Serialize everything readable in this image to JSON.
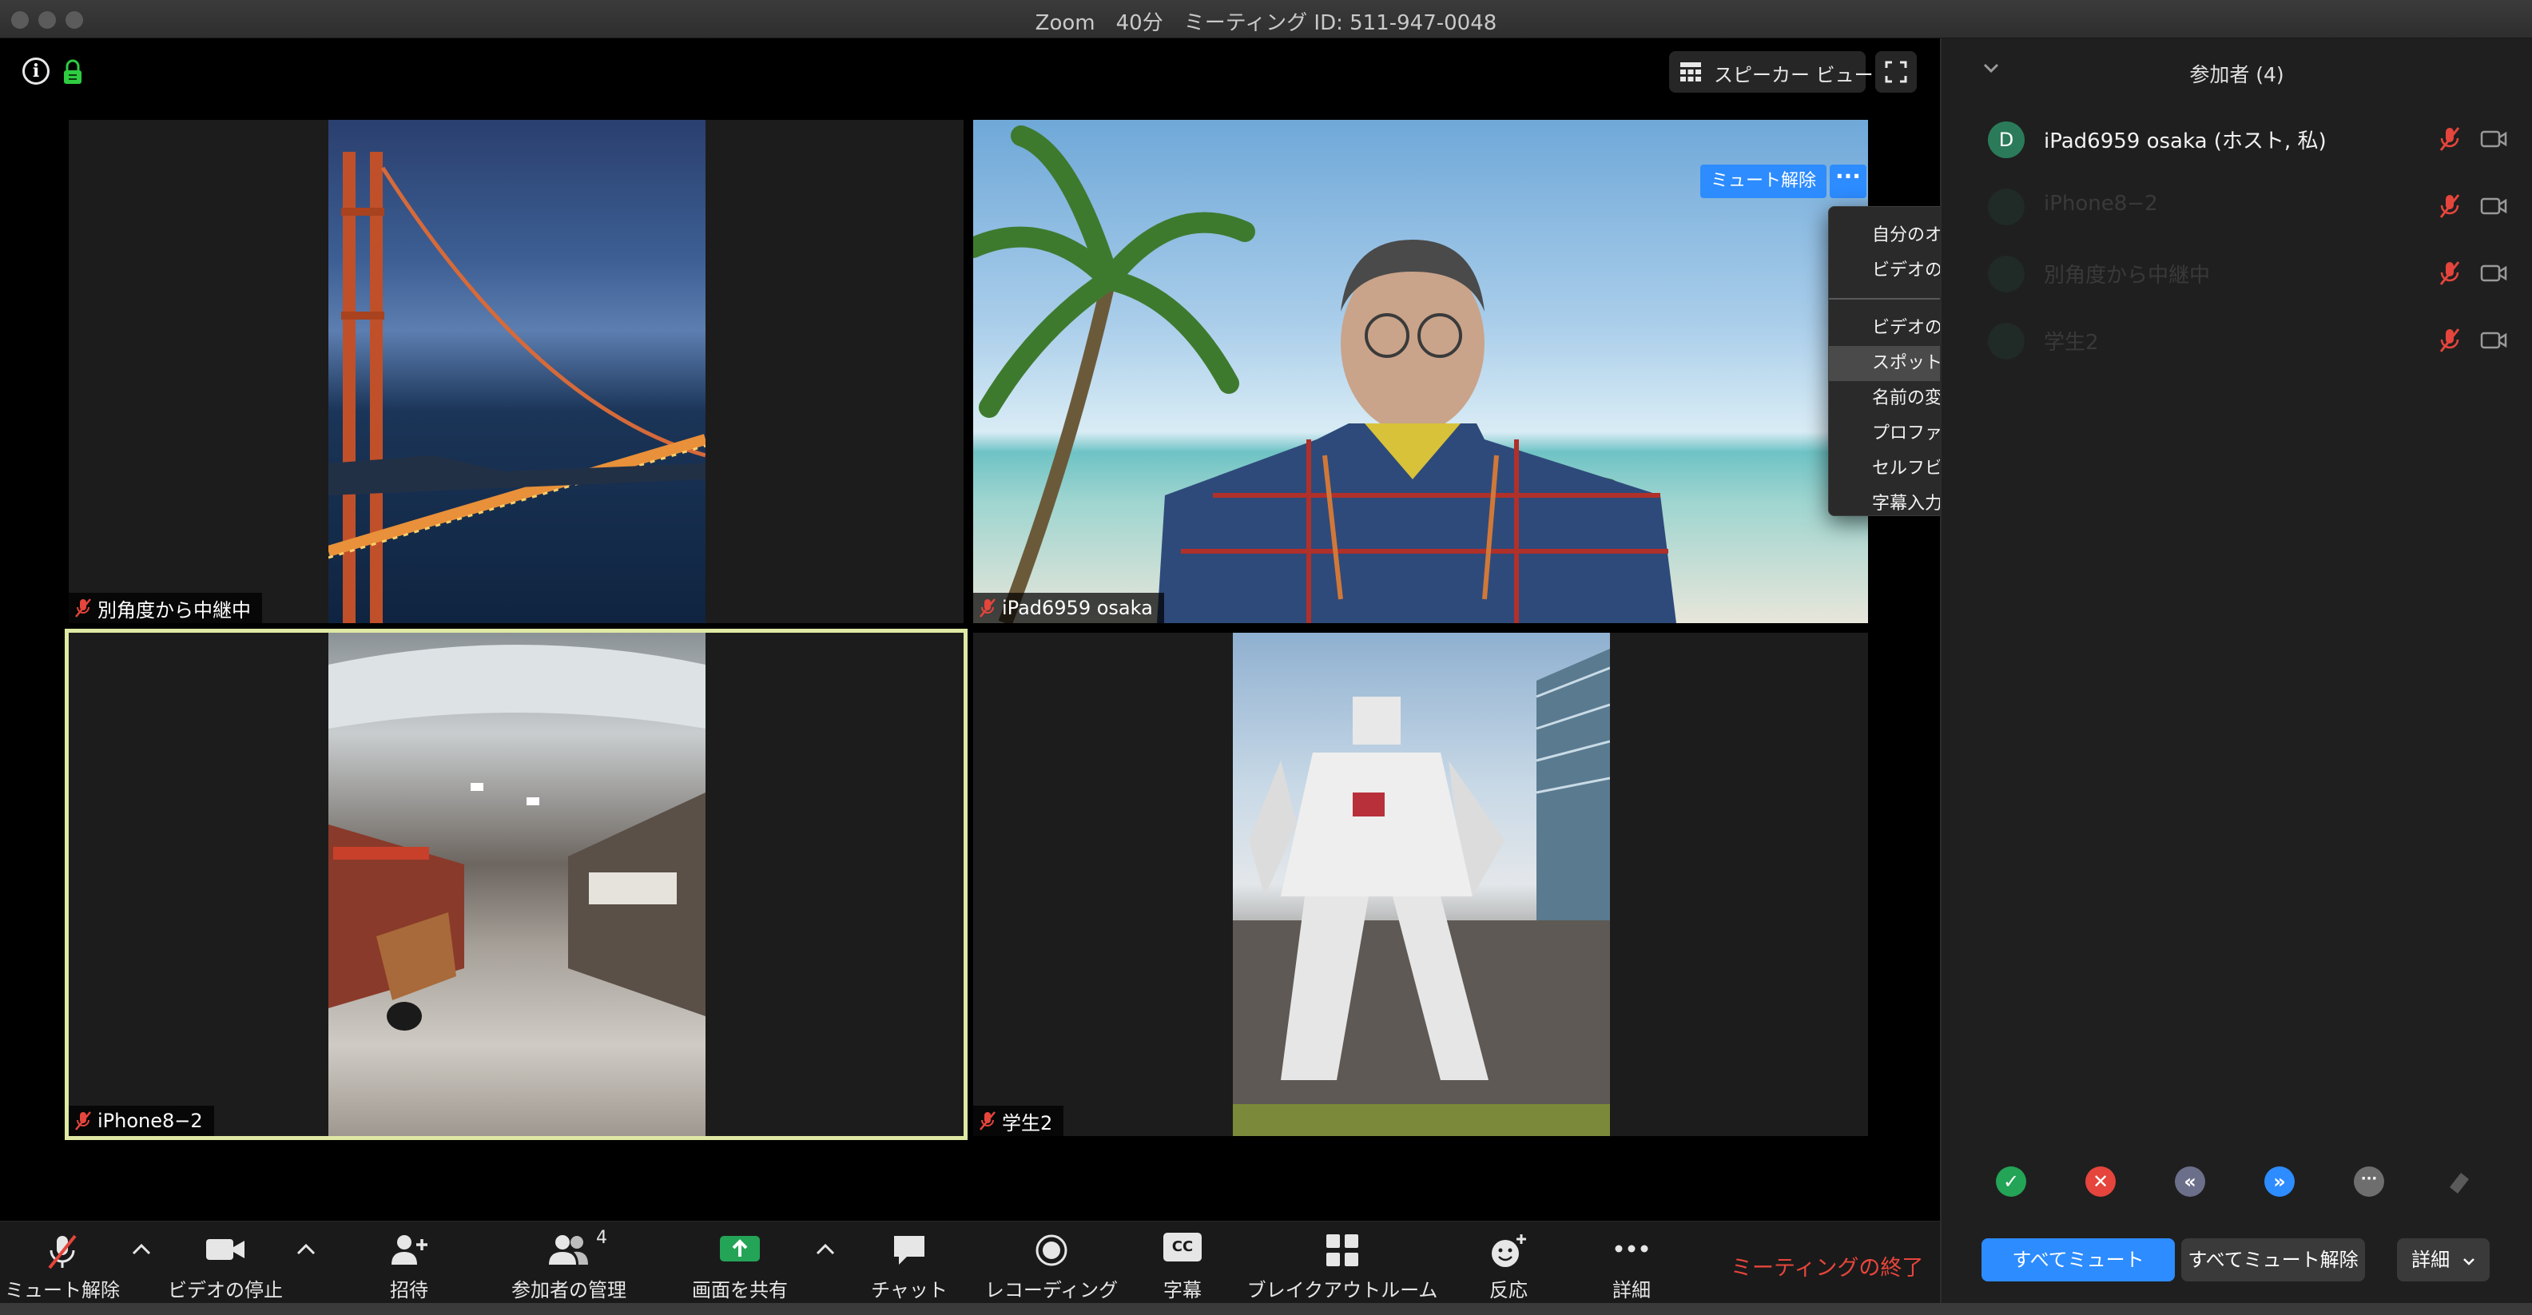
{
  "window": {
    "title": "Zoom　40分　ミーティング ID: 511-947-0048"
  },
  "top_controls": {
    "info_label": "i",
    "view_label": "スピーカー ビュー"
  },
  "tiles": [
    {
      "name": "別角度から中継中",
      "muted": true
    },
    {
      "name": "iPad6959 osaka",
      "muted": true
    },
    {
      "name": "iPhone8−2",
      "muted": true,
      "active_speaker": true
    },
    {
      "name": "学生2",
      "muted": true
    }
  ],
  "hover_controls": {
    "unmute_label": "ミュート解除",
    "more_label": "···"
  },
  "context_menu": {
    "items_top": [
      "自分のオーディオをミュート解除",
      "ビデオの停止"
    ],
    "items_bottom": [
      "ビデオの固定",
      "スポットライト ビデオ",
      "名前の変更",
      "プロファイル画像を編集",
      "セルフビューを非表示",
      "字幕入力の割り当て"
    ],
    "highlighted": "スポットライト ビデオ"
  },
  "panel": {
    "title": "参加者 (4)",
    "participants": [
      {
        "initial": "D",
        "name": "iPad6959 osaka (ホスト, 私)"
      },
      {
        "initial": "",
        "name": "iPhone8−2"
      },
      {
        "initial": "",
        "name": "別角度から中継中"
      },
      {
        "initial": "",
        "name": "学生2"
      }
    ],
    "reactions": [
      {
        "icon": "check-icon",
        "color": "#23a456",
        "glyph": "✓"
      },
      {
        "icon": "close-icon",
        "color": "#e5453c",
        "glyph": "✕"
      },
      {
        "icon": "slower-icon",
        "color": "#6b6f8a",
        "glyph": "«"
      },
      {
        "icon": "faster-icon",
        "color": "#2d8cff",
        "glyph": "»"
      },
      {
        "icon": "more-icon",
        "color": "#6e6e6e",
        "glyph": "···"
      },
      {
        "icon": "clear-icon",
        "color": "#5a5a5a",
        "glyph": ""
      }
    ],
    "mute_all_label": "すべてミュート",
    "unmute_all_label": "すべてミュート解除",
    "more_label": "詳細"
  },
  "toolbar": {
    "mute_label": "ミュート解除",
    "video_label": "ビデオの停止",
    "invite_label": "招待",
    "participants_label": "参加者の管理",
    "participants_count": "4",
    "share_label": "画面を共有",
    "chat_label": "チャット",
    "record_label": "レコーディング",
    "cc_label": "字幕",
    "cc_icon_text": "CC",
    "breakout_label": "ブレイクアウトルーム",
    "reaction_label": "反応",
    "more_label": "詳細",
    "end_label": "ミーティングの終了"
  },
  "colors": {
    "accent_blue": "#2d8cff",
    "active_border": "#dfe9a4",
    "end_red": "#e8453c",
    "share_green": "#23a456"
  }
}
